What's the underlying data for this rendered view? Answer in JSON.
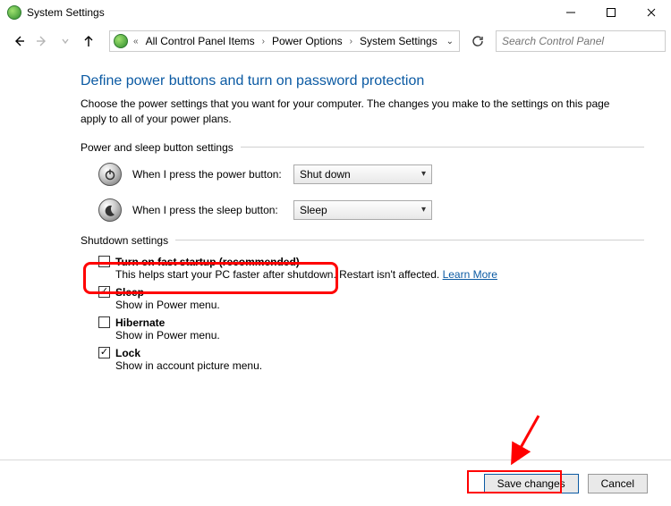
{
  "window": {
    "title": "System Settings"
  },
  "breadcrumb": {
    "items": [
      "All Control Panel Items",
      "Power Options",
      "System Settings"
    ]
  },
  "search": {
    "placeholder": "Search Control Panel"
  },
  "page": {
    "heading": "Define power buttons and turn on password protection",
    "subtext": "Choose the power settings that you want for your computer. The changes you make to the settings on this page apply to all of your power plans."
  },
  "groups": {
    "buttons_label": "Power and sleep button settings",
    "shutdown_label": "Shutdown settings"
  },
  "power_settings": {
    "power_button_label": "When I press the power button:",
    "power_button_value": "Shut down",
    "sleep_button_label": "When I press the sleep button:",
    "sleep_button_value": "Sleep"
  },
  "shutdown": {
    "fast_startup": {
      "label": "Turn on fast startup (recommended)",
      "desc": "This helps start your PC faster after shutdown. Restart isn't affected. ",
      "link": "Learn More",
      "checked": false
    },
    "sleep": {
      "label": "Sleep",
      "desc": "Show in Power menu.",
      "checked": true
    },
    "hibernate": {
      "label": "Hibernate",
      "desc": "Show in Power menu.",
      "checked": false
    },
    "lock": {
      "label": "Lock",
      "desc": "Show in account picture menu.",
      "checked": true
    }
  },
  "footer": {
    "save": "Save changes",
    "cancel": "Cancel"
  }
}
